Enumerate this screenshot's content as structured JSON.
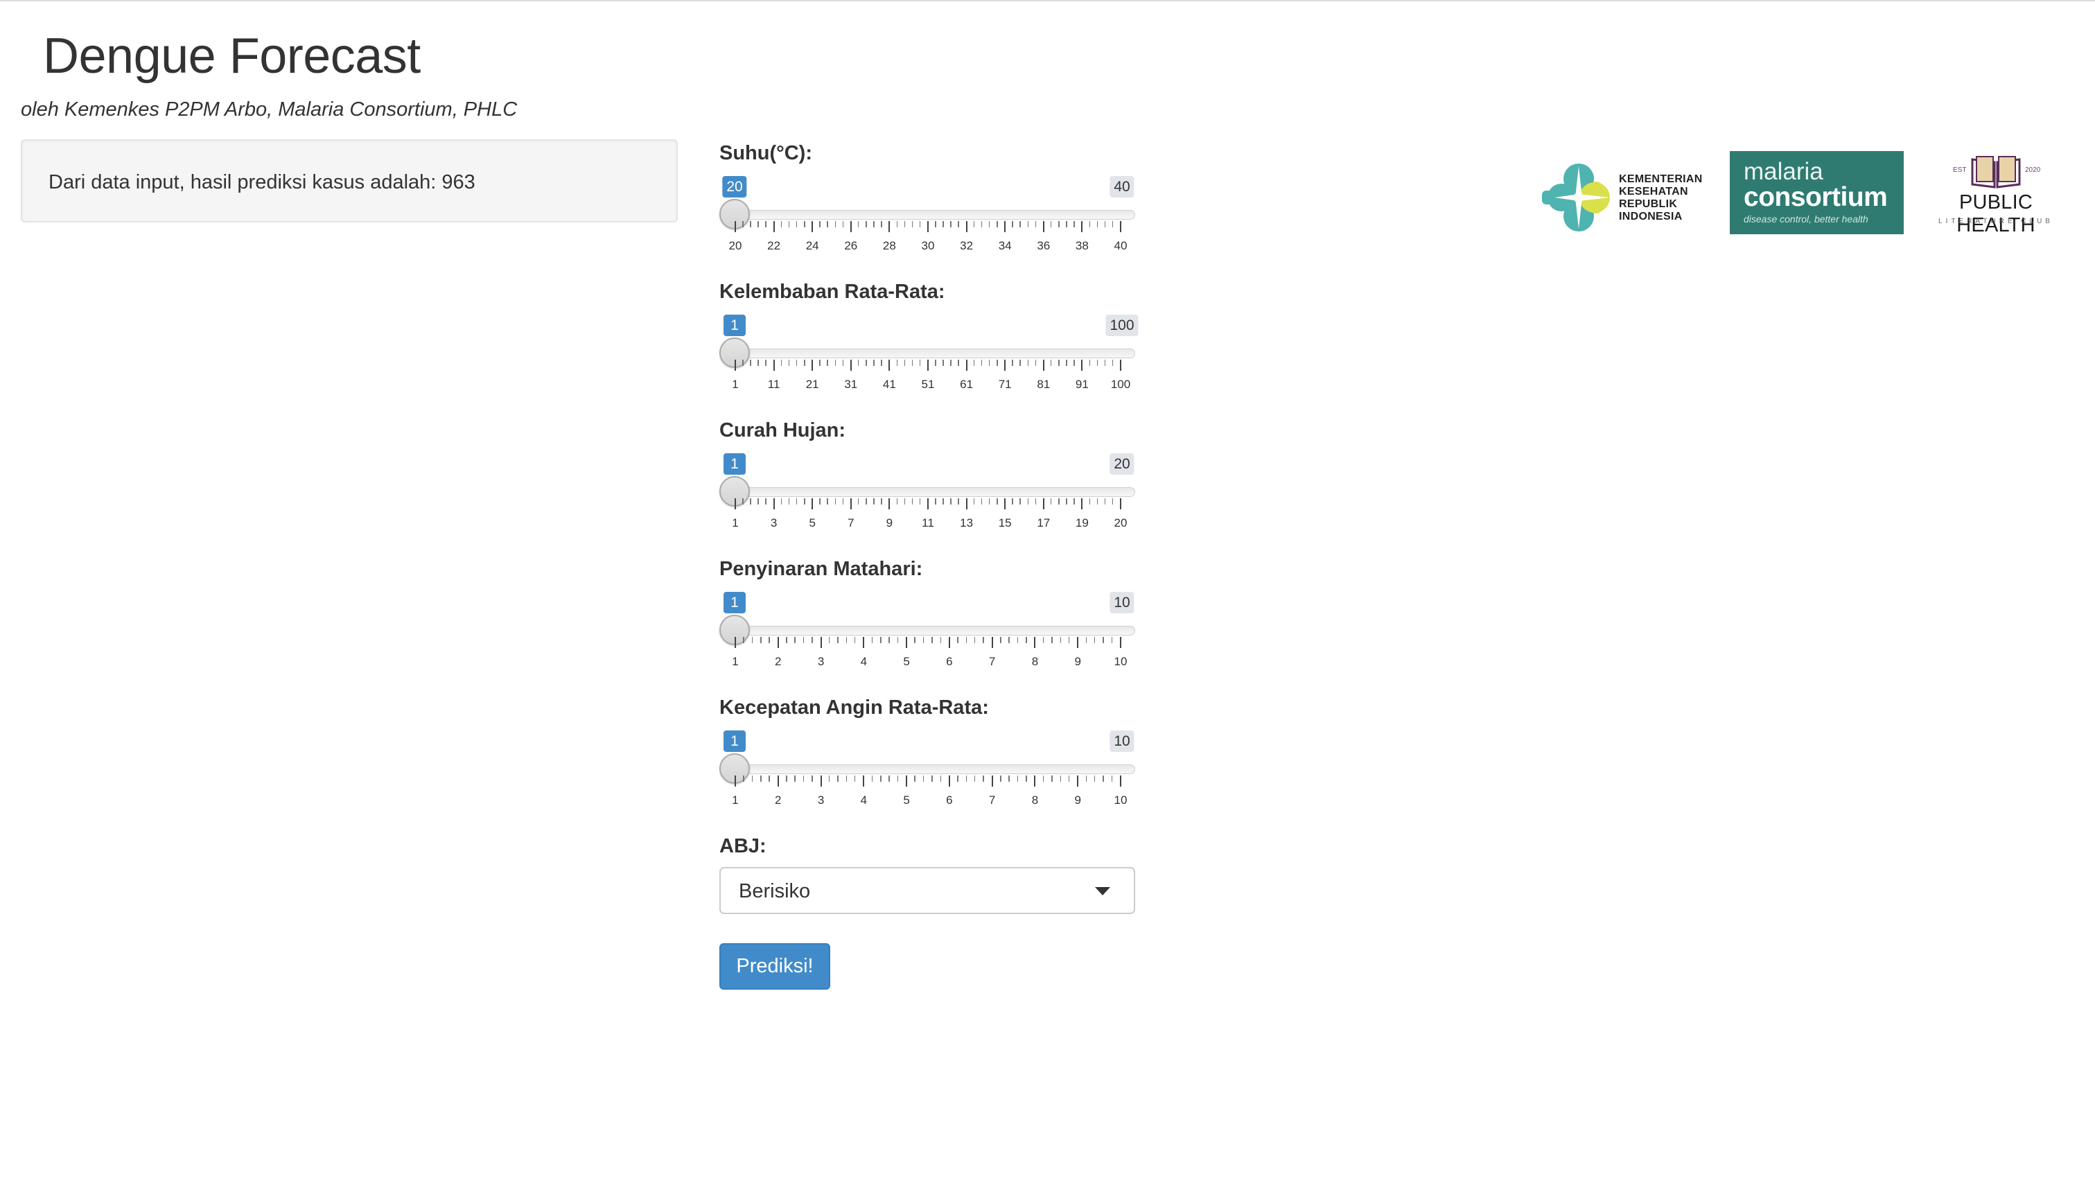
{
  "header": {
    "title": "Dengue Forecast",
    "subtitle": "oleh Kemenkes P2PM Arbo, Malaria Consortium, PHLC"
  },
  "result": {
    "text": "Dari data input, hasil prediksi kasus adalah: 963"
  },
  "sliders": [
    {
      "label": "Suhu(°C):",
      "min": 20,
      "max": 40,
      "value": 20,
      "min_label": "20",
      "max_label": "40",
      "tick_labels": [
        "20",
        "22",
        "24",
        "26",
        "28",
        "30",
        "32",
        "34",
        "36",
        "38",
        "40"
      ],
      "minor_per_gap": 4
    },
    {
      "label": "Kelembaban Rata-Rata:",
      "min": 1,
      "max": 100,
      "value": 1,
      "min_label": "1",
      "max_label": "100",
      "tick_labels": [
        "1",
        "11",
        "21",
        "31",
        "41",
        "51",
        "61",
        "71",
        "81",
        "91",
        "100"
      ],
      "minor_per_gap": 4
    },
    {
      "label": "Curah Hujan:",
      "min": 1,
      "max": 20,
      "value": 1,
      "min_label": "1",
      "max_label": "20",
      "tick_labels": [
        "1",
        "3",
        "5",
        "7",
        "9",
        "11",
        "13",
        "15",
        "17",
        "19",
        "20"
      ],
      "minor_per_gap": 4
    },
    {
      "label": "Penyinaran Matahari:",
      "min": 1,
      "max": 10,
      "value": 1,
      "min_label": "1",
      "max_label": "10",
      "tick_labels": [
        "1",
        "2",
        "3",
        "4",
        "5",
        "6",
        "7",
        "8",
        "9",
        "10"
      ],
      "minor_per_gap": 4
    },
    {
      "label": "Kecepatan Angin Rata-Rata:",
      "min": 1,
      "max": 10,
      "value": 1,
      "min_label": "1",
      "max_label": "10",
      "tick_labels": [
        "1",
        "2",
        "3",
        "4",
        "5",
        "6",
        "7",
        "8",
        "9",
        "10"
      ],
      "minor_per_gap": 4
    }
  ],
  "abj": {
    "label": "ABJ:",
    "selected": "Berisiko"
  },
  "predict_button": {
    "label": "Prediksi!"
  },
  "logos": {
    "kemenkes": {
      "lines": [
        "KEMENTERIAN",
        "KESEHATAN",
        "REPUBLIK",
        "INDONESIA"
      ]
    },
    "malaria": {
      "line1": "malaria",
      "line2": "consortium",
      "tagline": "disease control, better health"
    },
    "phlc": {
      "est": "EST",
      "year": "2020",
      "title": "PUBLIC HEALTH",
      "subtitle": "LITERATURE CLUB"
    }
  },
  "colors": {
    "accent": "#428bca",
    "malaria_bg": "#2f7b71",
    "kemenkes_teal": "#4fb3b0",
    "kemenkes_yellow": "#d9e04a"
  }
}
